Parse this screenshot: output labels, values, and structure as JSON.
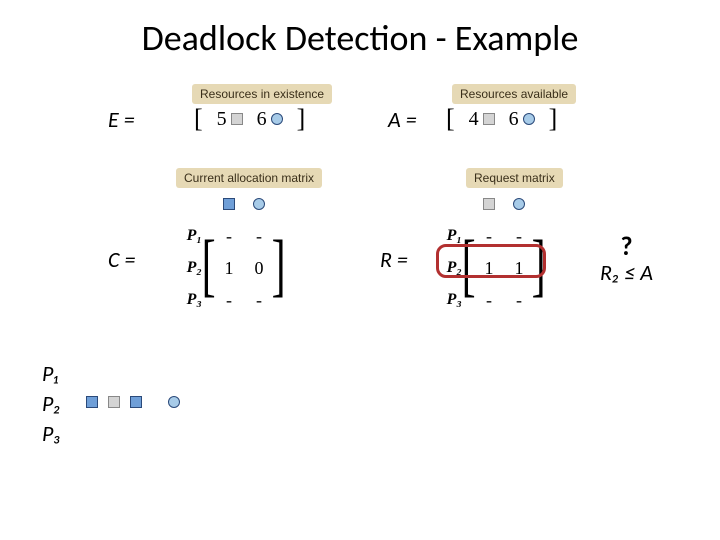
{
  "title": "Deadlock Detection - Example",
  "labels": {
    "resources_existence": "Resources in existence",
    "resources_available": "Resources available",
    "current_alloc": "Current allocation matrix",
    "request_matrix": "Request matrix"
  },
  "vectors": {
    "E": {
      "name": "E =",
      "vals": [
        "5",
        "6"
      ]
    },
    "A": {
      "name": "A =",
      "vals": [
        "4",
        "6"
      ]
    }
  },
  "matrices": {
    "C": {
      "name": "C =",
      "rows": [
        "P₁",
        "P₂",
        "P₃"
      ],
      "cells": [
        [
          "-",
          "-"
        ],
        [
          "1",
          "0"
        ],
        [
          "-",
          "-"
        ]
      ]
    },
    "R": {
      "name": "R =",
      "rows": [
        "P₁",
        "P₂",
        "P₃"
      ],
      "cells": [
        [
          "-",
          "-"
        ],
        [
          "1",
          "1"
        ],
        [
          "-",
          "-"
        ]
      ]
    }
  },
  "annotation": {
    "q": "?",
    "rel": "R₂ ≤ A"
  },
  "plist": [
    "P₁",
    "P₂",
    "P₃"
  ],
  "icons": {
    "square": "square-icon",
    "circle": "circle-icon"
  }
}
